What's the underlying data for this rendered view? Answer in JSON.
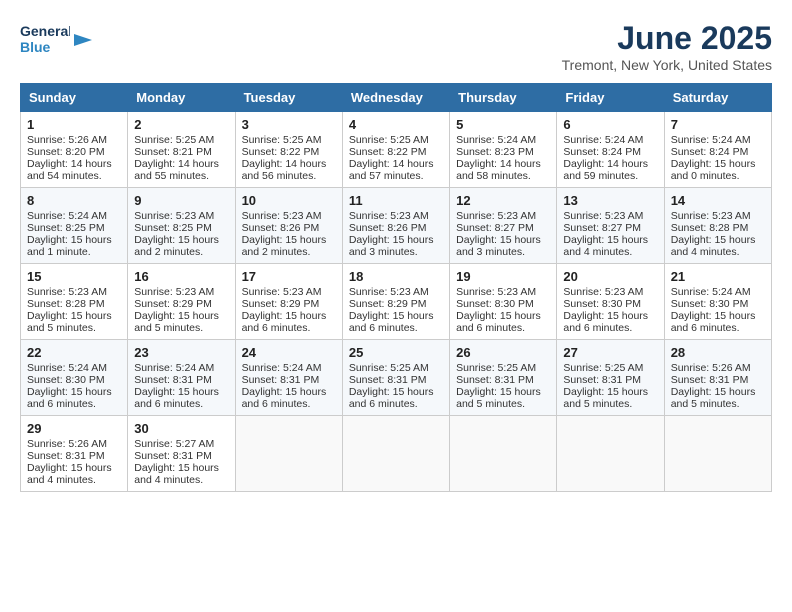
{
  "logo": {
    "line1": "General",
    "line2": "Blue"
  },
  "title": "June 2025",
  "location": "Tremont, New York, United States",
  "days_of_week": [
    "Sunday",
    "Monday",
    "Tuesday",
    "Wednesday",
    "Thursday",
    "Friday",
    "Saturday"
  ],
  "weeks": [
    [
      {
        "day": 1,
        "sunrise": "5:26 AM",
        "sunset": "8:20 PM",
        "daylight": "14 hours and 54 minutes."
      },
      {
        "day": 2,
        "sunrise": "5:25 AM",
        "sunset": "8:21 PM",
        "daylight": "14 hours and 55 minutes."
      },
      {
        "day": 3,
        "sunrise": "5:25 AM",
        "sunset": "8:22 PM",
        "daylight": "14 hours and 56 minutes."
      },
      {
        "day": 4,
        "sunrise": "5:25 AM",
        "sunset": "8:22 PM",
        "daylight": "14 hours and 57 minutes."
      },
      {
        "day": 5,
        "sunrise": "5:24 AM",
        "sunset": "8:23 PM",
        "daylight": "14 hours and 58 minutes."
      },
      {
        "day": 6,
        "sunrise": "5:24 AM",
        "sunset": "8:24 PM",
        "daylight": "14 hours and 59 minutes."
      },
      {
        "day": 7,
        "sunrise": "5:24 AM",
        "sunset": "8:24 PM",
        "daylight": "15 hours and 0 minutes."
      }
    ],
    [
      {
        "day": 8,
        "sunrise": "5:24 AM",
        "sunset": "8:25 PM",
        "daylight": "15 hours and 1 minute."
      },
      {
        "day": 9,
        "sunrise": "5:23 AM",
        "sunset": "8:25 PM",
        "daylight": "15 hours and 2 minutes."
      },
      {
        "day": 10,
        "sunrise": "5:23 AM",
        "sunset": "8:26 PM",
        "daylight": "15 hours and 2 minutes."
      },
      {
        "day": 11,
        "sunrise": "5:23 AM",
        "sunset": "8:26 PM",
        "daylight": "15 hours and 3 minutes."
      },
      {
        "day": 12,
        "sunrise": "5:23 AM",
        "sunset": "8:27 PM",
        "daylight": "15 hours and 3 minutes."
      },
      {
        "day": 13,
        "sunrise": "5:23 AM",
        "sunset": "8:27 PM",
        "daylight": "15 hours and 4 minutes."
      },
      {
        "day": 14,
        "sunrise": "5:23 AM",
        "sunset": "8:28 PM",
        "daylight": "15 hours and 4 minutes."
      }
    ],
    [
      {
        "day": 15,
        "sunrise": "5:23 AM",
        "sunset": "8:28 PM",
        "daylight": "15 hours and 5 minutes."
      },
      {
        "day": 16,
        "sunrise": "5:23 AM",
        "sunset": "8:29 PM",
        "daylight": "15 hours and 5 minutes."
      },
      {
        "day": 17,
        "sunrise": "5:23 AM",
        "sunset": "8:29 PM",
        "daylight": "15 hours and 6 minutes."
      },
      {
        "day": 18,
        "sunrise": "5:23 AM",
        "sunset": "8:29 PM",
        "daylight": "15 hours and 6 minutes."
      },
      {
        "day": 19,
        "sunrise": "5:23 AM",
        "sunset": "8:30 PM",
        "daylight": "15 hours and 6 minutes."
      },
      {
        "day": 20,
        "sunrise": "5:23 AM",
        "sunset": "8:30 PM",
        "daylight": "15 hours and 6 minutes."
      },
      {
        "day": 21,
        "sunrise": "5:24 AM",
        "sunset": "8:30 PM",
        "daylight": "15 hours and 6 minutes."
      }
    ],
    [
      {
        "day": 22,
        "sunrise": "5:24 AM",
        "sunset": "8:30 PM",
        "daylight": "15 hours and 6 minutes."
      },
      {
        "day": 23,
        "sunrise": "5:24 AM",
        "sunset": "8:31 PM",
        "daylight": "15 hours and 6 minutes."
      },
      {
        "day": 24,
        "sunrise": "5:24 AM",
        "sunset": "8:31 PM",
        "daylight": "15 hours and 6 minutes."
      },
      {
        "day": 25,
        "sunrise": "5:25 AM",
        "sunset": "8:31 PM",
        "daylight": "15 hours and 6 minutes."
      },
      {
        "day": 26,
        "sunrise": "5:25 AM",
        "sunset": "8:31 PM",
        "daylight": "15 hours and 5 minutes."
      },
      {
        "day": 27,
        "sunrise": "5:25 AM",
        "sunset": "8:31 PM",
        "daylight": "15 hours and 5 minutes."
      },
      {
        "day": 28,
        "sunrise": "5:26 AM",
        "sunset": "8:31 PM",
        "daylight": "15 hours and 5 minutes."
      }
    ],
    [
      {
        "day": 29,
        "sunrise": "5:26 AM",
        "sunset": "8:31 PM",
        "daylight": "15 hours and 4 minutes."
      },
      {
        "day": 30,
        "sunrise": "5:27 AM",
        "sunset": "8:31 PM",
        "daylight": "15 hours and 4 minutes."
      },
      null,
      null,
      null,
      null,
      null
    ]
  ]
}
